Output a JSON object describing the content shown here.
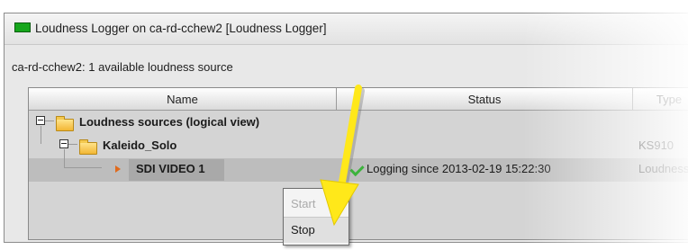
{
  "window": {
    "title": "Loudness Logger on ca-rd-cchew2 [Loudness Logger]",
    "icon": "green-monitor-icon"
  },
  "summary": "ca-rd-cchew2: 1 available loudness source",
  "table": {
    "columns": [
      "Name",
      "Status",
      "Type"
    ],
    "rows": [
      {
        "name": "Loudness sources (logical view)",
        "status": "",
        "type": "",
        "icon": "folder-icon"
      },
      {
        "name": "Kaleido_Solo",
        "status": "",
        "type": "KS910",
        "icon": "folder-icon"
      },
      {
        "name": "SDI VIDEO 1",
        "status": "Logging since 2013-02-19 15:22:30",
        "type": "Loudness",
        "icon": "audio-source-icon",
        "status_icon": "check-icon"
      }
    ]
  },
  "context_menu": {
    "items": [
      {
        "label": "Start",
        "enabled": false
      },
      {
        "label": "Stop",
        "enabled": true
      }
    ]
  },
  "annotation": {
    "arrow_color": "#ffe81a"
  }
}
